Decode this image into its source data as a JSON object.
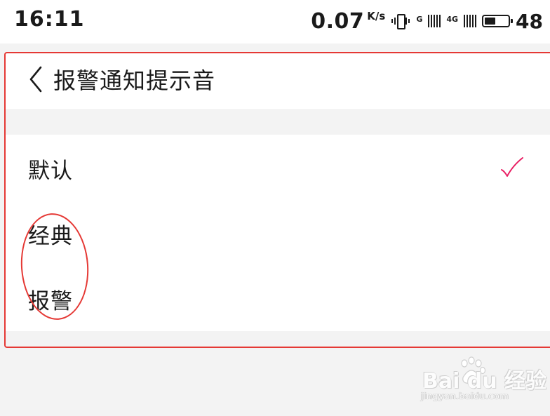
{
  "status_bar": {
    "time": "16:11",
    "net_speed": "0.07",
    "net_unit": "K/s",
    "network_label_1": "G",
    "network_label_2": "4G",
    "battery_level": "48",
    "battery_fraction": 0.48
  },
  "header": {
    "back_icon": "chevron-left-icon",
    "title": "报警通知提示音"
  },
  "sound_list": {
    "items": [
      {
        "label": "默认",
        "selected": true
      },
      {
        "label": "经典",
        "selected": false
      },
      {
        "label": "报警",
        "selected": false
      }
    ],
    "check_icon": "checkmark-icon",
    "accent_color": "#e91e63"
  },
  "annotation": {
    "color": "#e53935"
  },
  "watermark": {
    "brand": "Bai du 经验",
    "url": "jingyan.baidu.com",
    "icon": "paw-icon"
  }
}
